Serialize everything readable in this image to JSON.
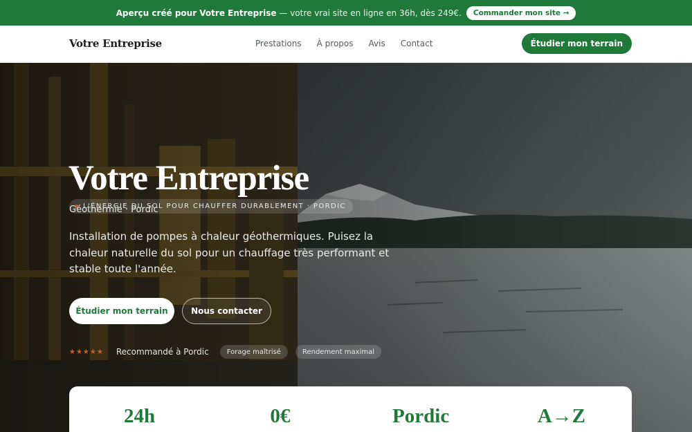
{
  "promo": {
    "brand": "Aperçu créé pour Votre Entreprise",
    "text": " — votre vrai site en ligne en 36h, dès 249€.",
    "button": "Commander mon site →"
  },
  "nav": {
    "logo": "Votre Entreprise",
    "links": [
      "Prestations",
      "À propos",
      "Avis",
      "Contact"
    ],
    "cta": "Étudier mon terrain"
  },
  "hero": {
    "eyebrow": "L'ÉNERGIE DU SOL POUR CHAUFFER DURABLEMENT · PORDIC",
    "title": "Votre Entreprise",
    "subtitle": "Géothermie · Pordic",
    "description": "Installation de pompes à chaleur géothermiques. Puisez la chaleur naturelle du sol pour un chauffage très performant et stable toute l'année.",
    "primary_button": "Étudier mon terrain",
    "secondary_button": "Nous contacter",
    "rating": 5,
    "stars": "★★★★★",
    "proof_text": "Recommandé à Pordic",
    "chips": [
      "Forage maîtrisé",
      "Rendement maximal"
    ]
  },
  "stats": [
    "24h",
    "0€",
    "Pordic",
    "A→Z"
  ],
  "colors": {
    "brand_green": "#1f7a3a",
    "accent_orange": "#c4622d"
  }
}
